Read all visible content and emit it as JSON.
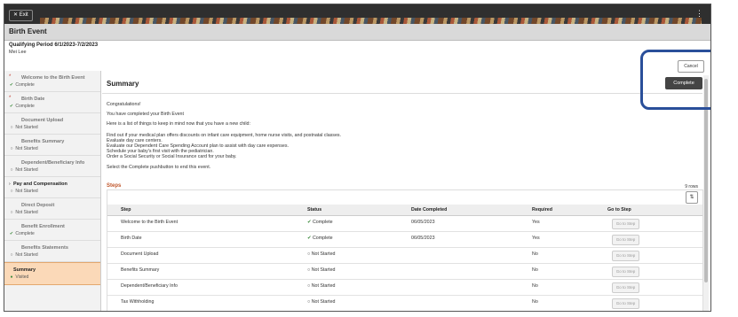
{
  "header": {
    "exit_label": "Exit",
    "exit_icon": "close-icon",
    "menu_icon": "kebab-icon"
  },
  "title": "Birth Event",
  "period": "Qualifying Period 6/1/2023-7/2/2023",
  "person": "Mei Lee",
  "buttons": {
    "cancel": "Cancel",
    "complete": "Complete"
  },
  "sidebar": {
    "items": [
      {
        "label": "Welcome to the Birth Event",
        "status": "Complete",
        "icon": "✔",
        "required": "*"
      },
      {
        "label": "Birth Date",
        "status": "Complete",
        "icon": "✔",
        "required": "*"
      },
      {
        "label": "Document Upload",
        "status": "Not Started",
        "icon": "○",
        "required": ""
      },
      {
        "label": "Benefits Summary",
        "status": "Not Started",
        "icon": "○",
        "required": ""
      },
      {
        "label": "Dependent/Beneficiary Info",
        "status": "Not Started",
        "icon": "○",
        "required": ""
      },
      {
        "label": "Pay and Compensation",
        "status": "Not Started",
        "icon": "○",
        "required": ""
      },
      {
        "label": "Direct Deposit",
        "status": "Not Started",
        "icon": "○",
        "required": ""
      },
      {
        "label": "Benefit Enrollment",
        "status": "Complete",
        "icon": "✔",
        "required": ""
      },
      {
        "label": "Benefits Statements",
        "status": "Not Started",
        "icon": "○",
        "required": ""
      },
      {
        "label": "Summary",
        "status": "Visited",
        "icon": "●",
        "required": ""
      }
    ]
  },
  "main": {
    "heading": "Summary",
    "lines": [
      "Congratulations!",
      "You have completed your Birth Event",
      "Here is a list of things to keep in mind now that you have a new child:",
      "Find out if your medical plan offers discounts on infant care equipment, home nurse visits, and postnatal classes.",
      "Evaluate day care centers.",
      "Evaluate our Dependent Care Spending Account plan to assist with day care expenses.",
      "Schedule your baby's first visit with the pediatrician.",
      "Order a Social Security or Social Insurance card for your baby.",
      "Select the Complete pushbutton to end this event."
    ],
    "steps_title": "Steps",
    "rows_count": "9 rows",
    "columns": [
      "Step",
      "Status",
      "Date Completed",
      "Required",
      "Go to Step"
    ],
    "rows": [
      {
        "step": "Welcome to the Birth Event",
        "status_icon": "✔",
        "status": "Complete",
        "date": "06/05/2023",
        "required": "Yes",
        "go": "Go to Step"
      },
      {
        "step": "Birth Date",
        "status_icon": "✔",
        "status": "Complete",
        "date": "06/05/2023",
        "required": "Yes",
        "go": "Go to Step"
      },
      {
        "step": "Document Upload",
        "status_icon": "○",
        "status": "Not Started",
        "date": "",
        "required": "No",
        "go": "Go to Step"
      },
      {
        "step": "Benefits Summary",
        "status_icon": "○",
        "status": "Not Started",
        "date": "",
        "required": "No",
        "go": "Go to Step"
      },
      {
        "step": "Dependent/Beneficiary Info",
        "status_icon": "○",
        "status": "Not Started",
        "date": "",
        "required": "No",
        "go": "Go to Step"
      },
      {
        "step": "Tax Withholding",
        "status_icon": "○",
        "status": "Not Started",
        "date": "",
        "required": "No",
        "go": "Go to Step"
      }
    ]
  }
}
